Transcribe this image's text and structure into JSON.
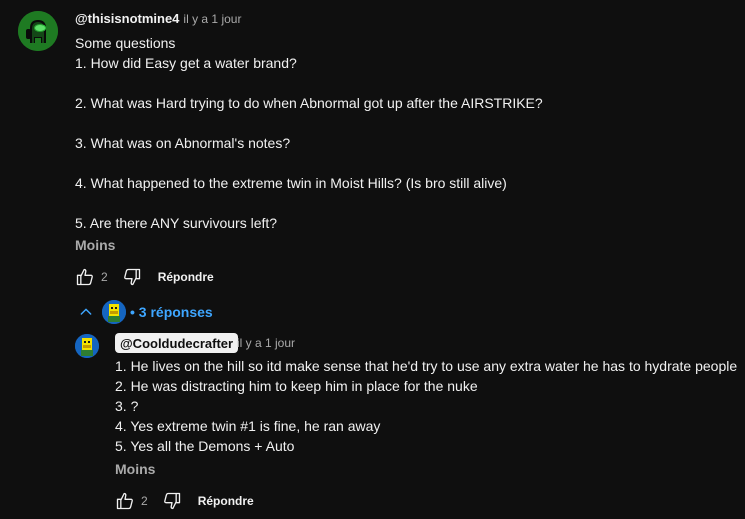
{
  "comment": {
    "author": "@thisisnotmine4",
    "time": "il y a 1 jour",
    "lines": [
      "Some questions",
      "1. How did Easy get a water brand?",
      "",
      "2. What was Hard trying to do when Abnormal got up after the AIRSTRIKE?",
      "",
      "3. What was on Abnormal's notes?",
      "",
      "4. What happened to the extreme twin in Moist Hills? (Is bro still alive)",
      "",
      "5. Are there ANY survivours left?"
    ],
    "less_label": "Moins",
    "like_count": "2",
    "reply_label": "Répondre",
    "avatar_icon": "among-us-crewmate-avatar"
  },
  "replies_toggle": {
    "label": "• 3 réponses",
    "icon": "chevron-up-icon"
  },
  "reply": {
    "author": "@Cooldudecrafter",
    "time": "il y a 1 jour",
    "lines": [
      "1. He lives on the hill so itd make sense that he'd try to use any extra water he has to hydrate people",
      "2. He was distracting him to keep him in place for the nuke",
      "3. ?",
      "4. Yes extreme twin #1 is fine, he ran away",
      "5. Yes all the Demons + Auto"
    ],
    "less_label": "Moins",
    "like_count": "2",
    "reply_label": "Répondre",
    "avatar_icon": "blocky-character-avatar"
  },
  "colors": {
    "background": "#0f0f0f",
    "text": "#f1f1f1",
    "secondary_text": "#aaaaaa",
    "link_blue": "#3ea6ff",
    "avatar_green": "#1e7a22"
  }
}
